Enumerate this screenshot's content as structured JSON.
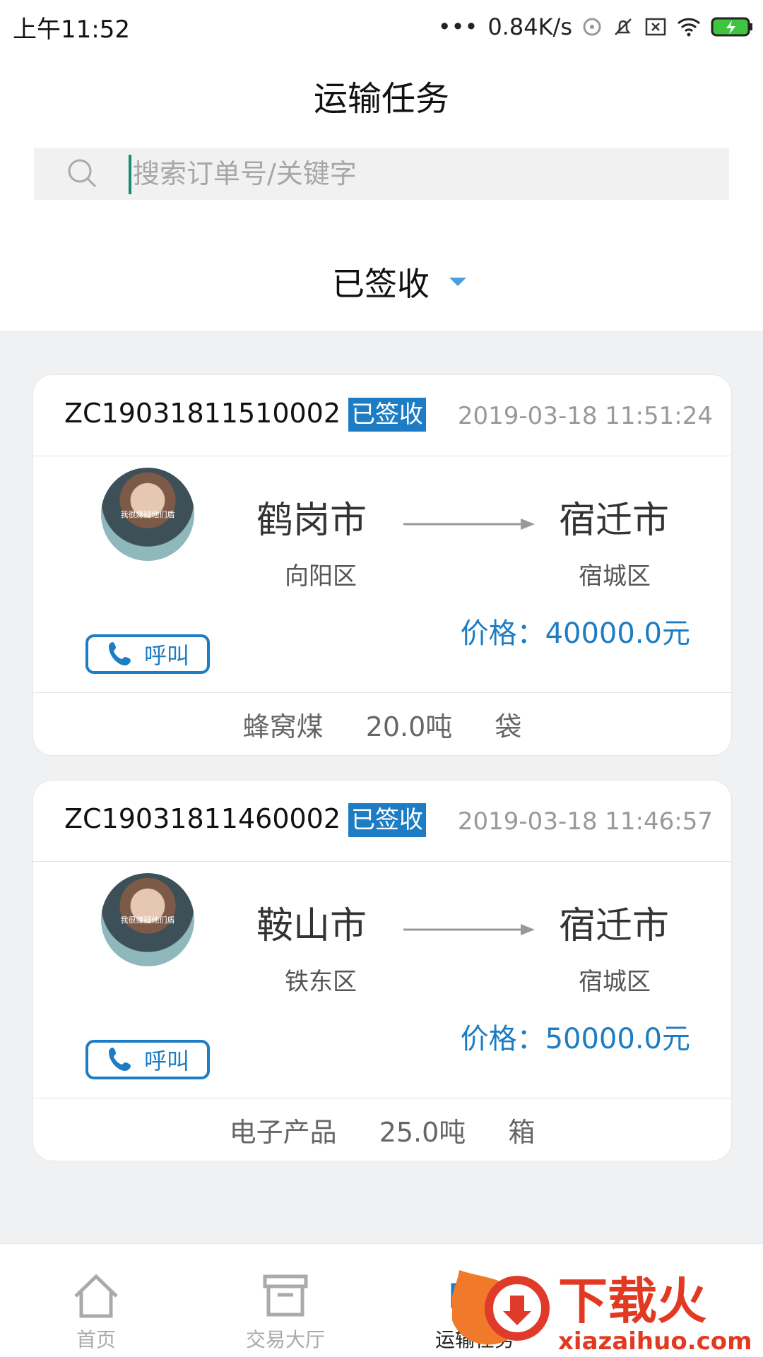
{
  "status_bar": {
    "time": "上午11:52",
    "network_speed": "0.84K/s"
  },
  "header": {
    "title": "运输任务",
    "search_placeholder": "搜索订单号/关键字",
    "filter_label": "已签收"
  },
  "orders": [
    {
      "order_no": "ZC19031811510002",
      "status": "已签收",
      "time": "2019-03-18 11:51:24",
      "avatar_caption": "我很嫌疑他们盾",
      "from_city": "鹤岗市",
      "from_district": "向阳区",
      "to_city": "宿迁市",
      "to_district": "宿城区",
      "price": "价格：40000.0元",
      "call_label": "呼叫",
      "cargo": "蜂窝煤",
      "weight": "20.0吨",
      "package": "袋"
    },
    {
      "order_no": "ZC19031811460002",
      "status": "已签收",
      "time": "2019-03-18 11:46:57",
      "avatar_caption": "我很嫌疑他们盾",
      "from_city": "鞍山市",
      "from_district": "铁东区",
      "to_city": "宿迁市",
      "to_district": "宿城区",
      "price": "价格：50000.0元",
      "call_label": "呼叫",
      "cargo": "电子产品",
      "weight": "25.0吨",
      "package": "箱"
    }
  ],
  "tabbar": {
    "items": [
      {
        "label": "首页",
        "icon": "home-icon"
      },
      {
        "label": "交易大厅",
        "icon": "box-icon"
      },
      {
        "label": "运输任务",
        "icon": "truck-icon"
      }
    ]
  },
  "watermark": {
    "brand": "下载火",
    "url": "xiazaihuo.com"
  },
  "colors": {
    "accent": "#1d7dc4",
    "caret": "#4d9de0"
  }
}
